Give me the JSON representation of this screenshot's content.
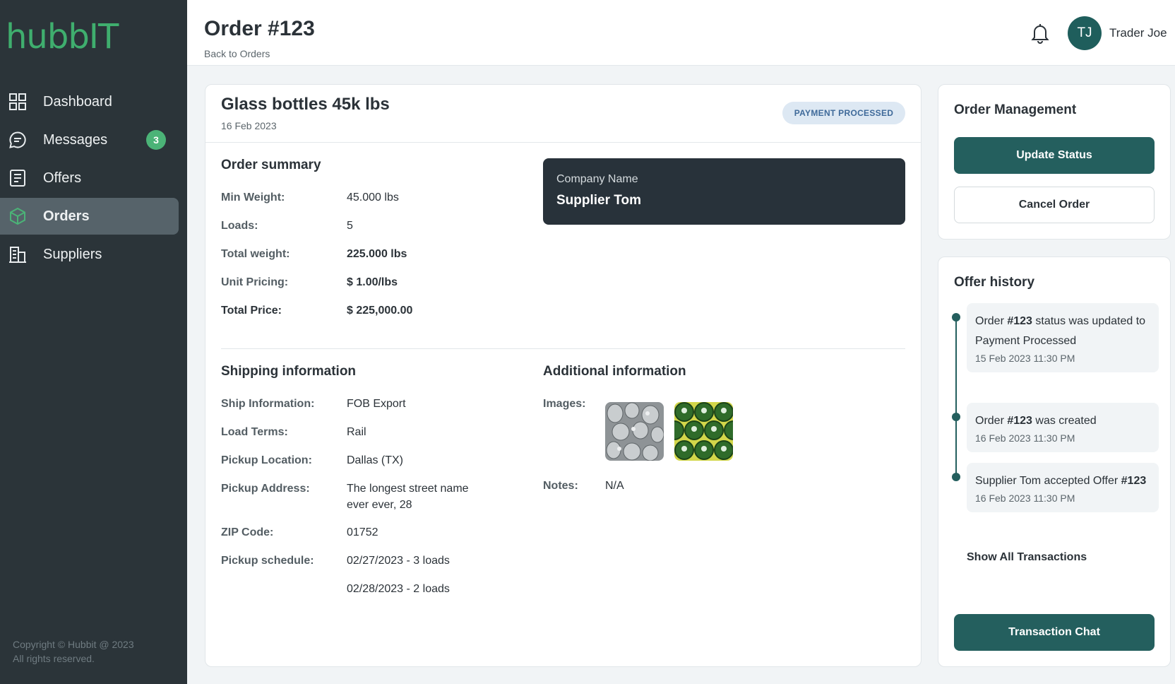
{
  "app": {
    "logo": "hubbIT"
  },
  "sidebar": {
    "items": [
      {
        "label": "Dashboard",
        "icon": "dashboard-grid-icon"
      },
      {
        "label": "Messages",
        "icon": "chat-bubble-icon",
        "badge": "3"
      },
      {
        "label": "Offers",
        "icon": "document-list-icon"
      },
      {
        "label": "Orders",
        "icon": "box-icon",
        "active": true
      },
      {
        "label": "Suppliers",
        "icon": "building-icon"
      }
    ],
    "copyright_line1": "Copyright © Hubbit @ 2023",
    "copyright_line2": "All rights reserved."
  },
  "header": {
    "title": "Order #123",
    "back_link": "Back to Orders",
    "user_initials": "TJ",
    "user_name": "Trader Joe"
  },
  "order": {
    "product_title": "Glass bottles 45k lbs",
    "date": "16 Feb 2023",
    "status": "PAYMENT PROCESSED",
    "summary": {
      "title": "Order summary",
      "rows": [
        {
          "label": "Min Weight:",
          "value": "45.000 lbs"
        },
        {
          "label": "Loads:",
          "value": "5"
        },
        {
          "label": "Total weight:",
          "value": "225.000 lbs"
        },
        {
          "label": "Unit Pricing:",
          "value": "$ 1.00/lbs"
        },
        {
          "label": "Total Price:",
          "value": "$ 225,000.00"
        }
      ]
    },
    "company": {
      "label": "Company Name",
      "name": "Supplier Tom"
    },
    "shipping": {
      "title": "Shipping information",
      "rows": [
        {
          "label": "Ship Information:",
          "value": "FOB Export"
        },
        {
          "label": "Load Terms:",
          "value": "Rail"
        },
        {
          "label": "Pickup Location:",
          "value": "Dallas (TX)"
        },
        {
          "label": "Pickup Address:",
          "value_line1": "The longest street name",
          "value_line2": "ever ever, 28"
        },
        {
          "label": "ZIP Code:",
          "value": "01752"
        },
        {
          "label": "Pickup schedule:",
          "value": "02/27/2023 - 3 loads",
          "value2": "02/28/2023 - 2 loads"
        }
      ]
    },
    "additional": {
      "title": "Additional information",
      "images_label": "Images:",
      "notes_label": "Notes:",
      "notes_value": "N/A"
    }
  },
  "management": {
    "title": "Order Management",
    "update_status": "Update Status",
    "cancel_order": "Cancel Order"
  },
  "history": {
    "title": "Offer history",
    "items": [
      {
        "pre": "Order ",
        "bold": "#123",
        "post": " status was updated to Payment Processed",
        "time": "15 Feb 2023  11:30 PM"
      },
      {
        "pre": "Order ",
        "bold": "#123",
        "post": " was created",
        "time": "16 Feb 2023  11:30 PM"
      },
      {
        "pre": "Supplier Tom accepted Offer ",
        "bold": "#123",
        "post": "",
        "time": "16 Feb 2023  11:30 PM"
      }
    ],
    "show_all": "Show All Transactions",
    "chat_button": "Transaction Chat"
  },
  "colors": {
    "sidebar_bg": "#2b3439",
    "brand_green": "#3fae6e",
    "primary_teal": "#245f5e",
    "status_pill_bg": "#dde8f3",
    "status_pill_text": "#3f6a9a"
  }
}
